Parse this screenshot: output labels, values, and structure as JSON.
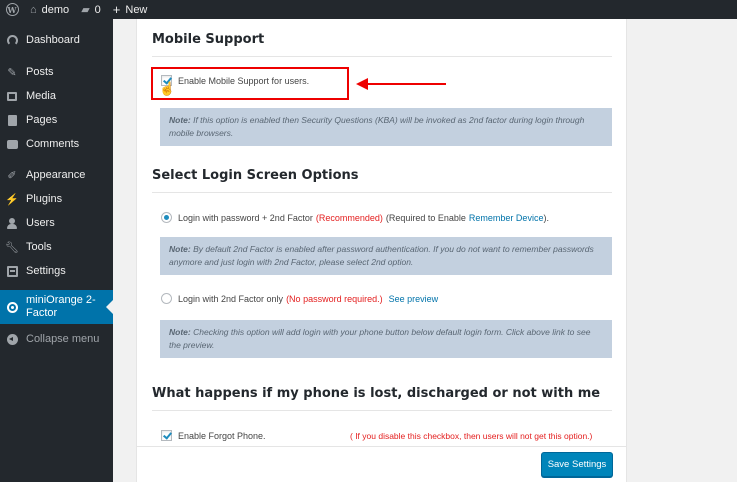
{
  "admin_bar": {
    "site_name": "demo",
    "comments_count": "0",
    "new_label": "New"
  },
  "sidebar": {
    "items": [
      {
        "label": "Dashboard",
        "icon": "dashboard-icon"
      },
      {
        "label": "Posts",
        "icon": "pin-icon"
      },
      {
        "label": "Media",
        "icon": "media-icon"
      },
      {
        "label": "Pages",
        "icon": "pages-icon"
      },
      {
        "label": "Comments",
        "icon": "comments-icon"
      },
      {
        "label": "Appearance",
        "icon": "brush-icon"
      },
      {
        "label": "Plugins",
        "icon": "plug-icon"
      },
      {
        "label": "Users",
        "icon": "users-icon"
      },
      {
        "label": "Tools",
        "icon": "wrench-icon"
      },
      {
        "label": "Settings",
        "icon": "settings-icon"
      },
      {
        "label_line1": "miniOrange 2-",
        "label_line2": "Factor",
        "icon": "miniorange-icon",
        "active": true
      }
    ],
    "collapse_label": "Collapse menu"
  },
  "mobile_support": {
    "title": "Mobile Support",
    "checkbox_label": "Enable Mobile Support for users.",
    "checked": true,
    "note_label": "Note:",
    "note_text": " If this option is enabled then Security Questions (KBA) will be invoked as 2nd factor during login through mobile browsers."
  },
  "login_options": {
    "title": "Select Login Screen Options",
    "option1": {
      "label": "Login with password + 2nd Factor",
      "recommended": "(Recommended)",
      "required_prefix": "(Required to Enable",
      "link": "Remember Device",
      "required_suffix": ").",
      "selected": true
    },
    "note1_label": "Note:",
    "note1_text": " By default 2nd Factor is enabled after password authentication. If you do not want to remember passwords anymore and just login with 2nd Factor, please select 2nd option.",
    "option2": {
      "label": "Login with 2nd Factor only",
      "no_password": "(No password required.)",
      "link": "See preview",
      "selected": false
    },
    "note2_label": "Note:",
    "note2_text": " Checking this option will add login with your phone button below default login form. Click above link to see the preview."
  },
  "phone_lost": {
    "title": "What happens if my phone is lost, discharged or not with me",
    "checkbox_label": "Enable Forgot Phone.",
    "checked": true,
    "warning": "( If you disable this checkbox, then users will not get this option.)"
  },
  "save_button_label": "Save Settings",
  "colors": {
    "admin_dark": "#23282d",
    "accent_blue": "#0073aa",
    "note_bg": "#c3d0df",
    "highlight_red": "#e00000"
  }
}
